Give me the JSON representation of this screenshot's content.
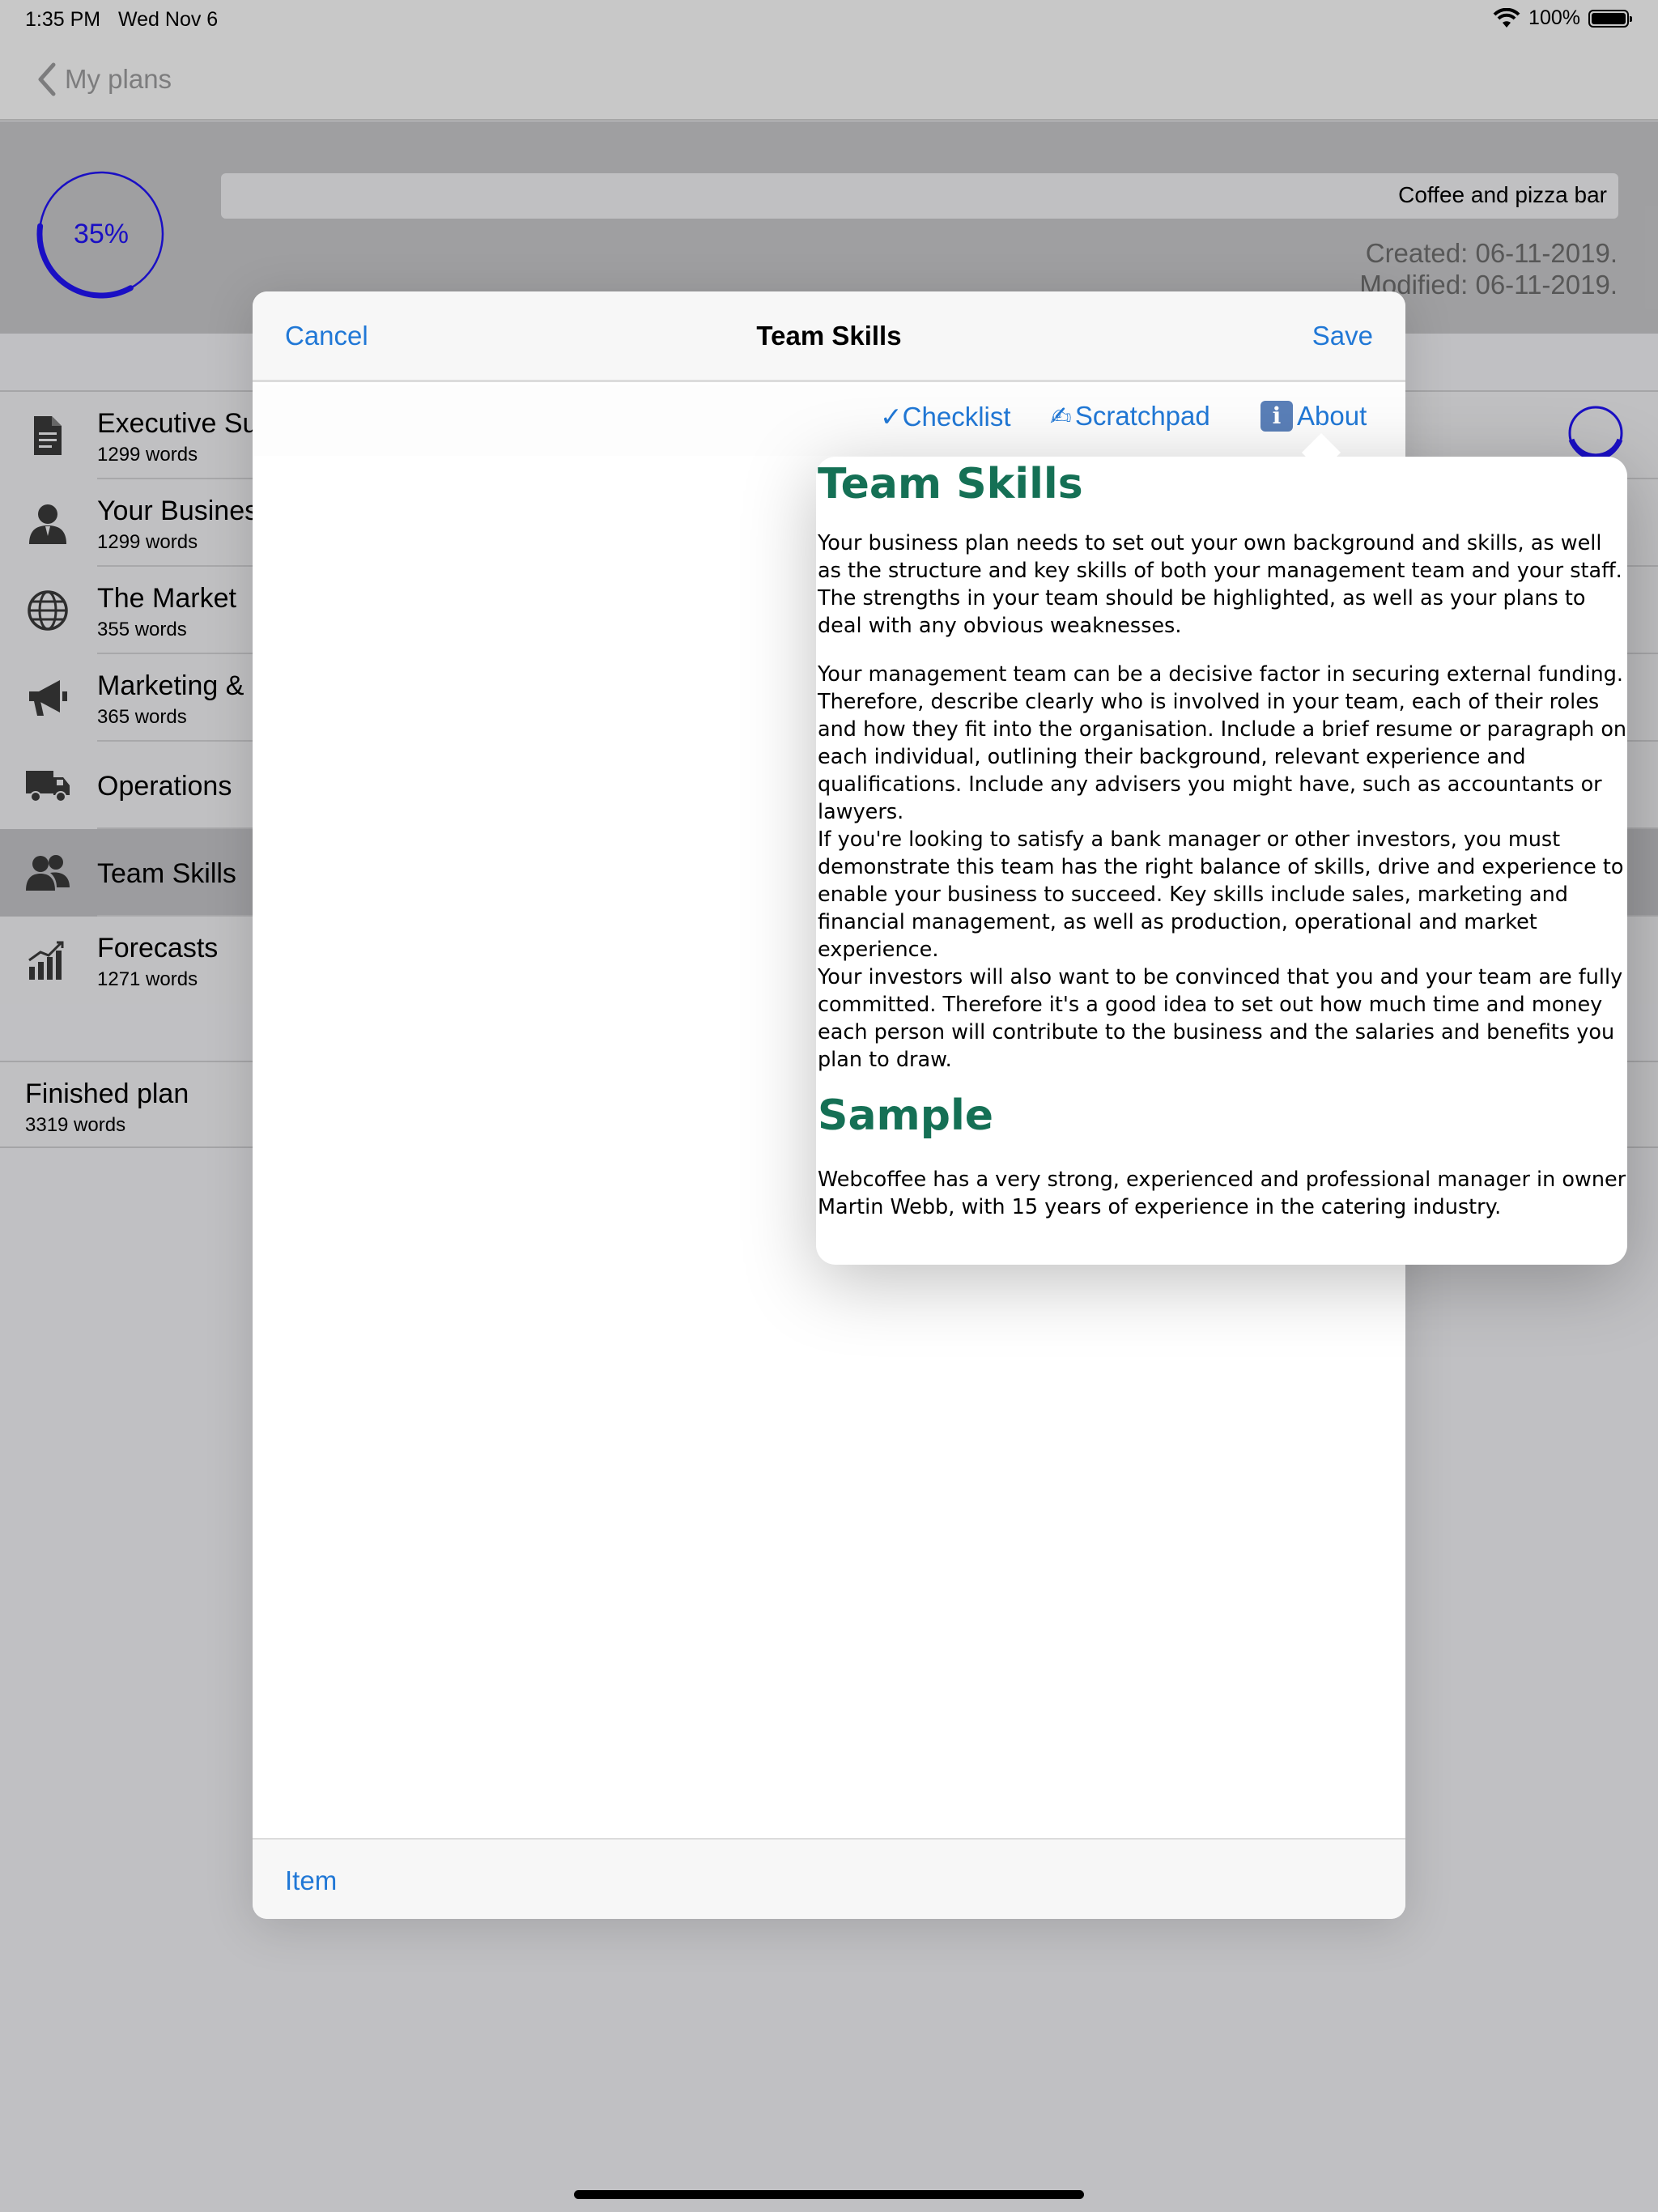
{
  "status_bar": {
    "time": "1:35 PM",
    "date": "Wed Nov 6",
    "battery": "100%"
  },
  "nav": {
    "back_label": "My plans"
  },
  "header": {
    "progress_label": "35%",
    "progress_value": 0.35,
    "plan_name": "Coffee and pizza bar",
    "created": "Created: 06-11-2019.",
    "modified": "Modified: 06-11-2019."
  },
  "sections": [
    {
      "title": "Executive Su",
      "words": "1299 words",
      "icon": "document-icon"
    },
    {
      "title": "Your Busines",
      "words": "1299 words",
      "icon": "person-icon"
    },
    {
      "title": "The Market",
      "words": "355 words",
      "icon": "globe-icon"
    },
    {
      "title": "Marketing &",
      "words": "365 words",
      "icon": "megaphone-icon"
    },
    {
      "title": "Operations",
      "words": "",
      "icon": "truck-icon"
    },
    {
      "title": "Team Skills",
      "words": "",
      "icon": "team-icon"
    },
    {
      "title": "Forecasts",
      "words": "1271 words",
      "icon": "chart-icon"
    }
  ],
  "finished": {
    "title": "Finished plan",
    "words": "3319 words"
  },
  "modal": {
    "cancel": "Cancel",
    "title": "Team Skills",
    "save": "Save",
    "toolbar": {
      "checklist": "✓Checklist",
      "scratchpad": "Scratchpad",
      "about": "About",
      "info_glyph": "i"
    },
    "bottom_item": "Item"
  },
  "popover": {
    "heading": "Team Skills",
    "p1": "Your business plan needs to set out your own background and skills, as well as the structure and key skills of both your management team and your staff. The strengths in your team should be highlighted, as well as your plans to deal with any obvious weaknesses.",
    "p2": "Your management team can be a decisive factor in securing external funding. Therefore, describe clearly who is involved in your team, each of their roles and how they fit into the organisation. Include a brief resume or paragraph on each individual, outlining their background, relevant experience and qualifications. Include any advisers you might have, such as accountants or lawyers.",
    "p3": "If you're looking to satisfy a bank manager or other investors, you must demonstrate this team has the right balance of skills, drive and experience to enable your business to succeed. Key skills include sales, marketing and financial management, as well as production, operational and market experience.",
    "p4": "Your investors will also want to be convinced that you and your team are fully committed. Therefore it's a good idea to set out how much time and money each person will contribute to the business and the salaries and benefits you plan to draw.",
    "sample_heading": "Sample",
    "sample_text": "Webcoffee has a very strong, experienced and professional manager in owner Martin Webb, with 15 years of experience in the catering industry."
  },
  "colors": {
    "accent": "#2178d6",
    "heading_green": "#157055",
    "progress_blue": "#1b10c8"
  }
}
